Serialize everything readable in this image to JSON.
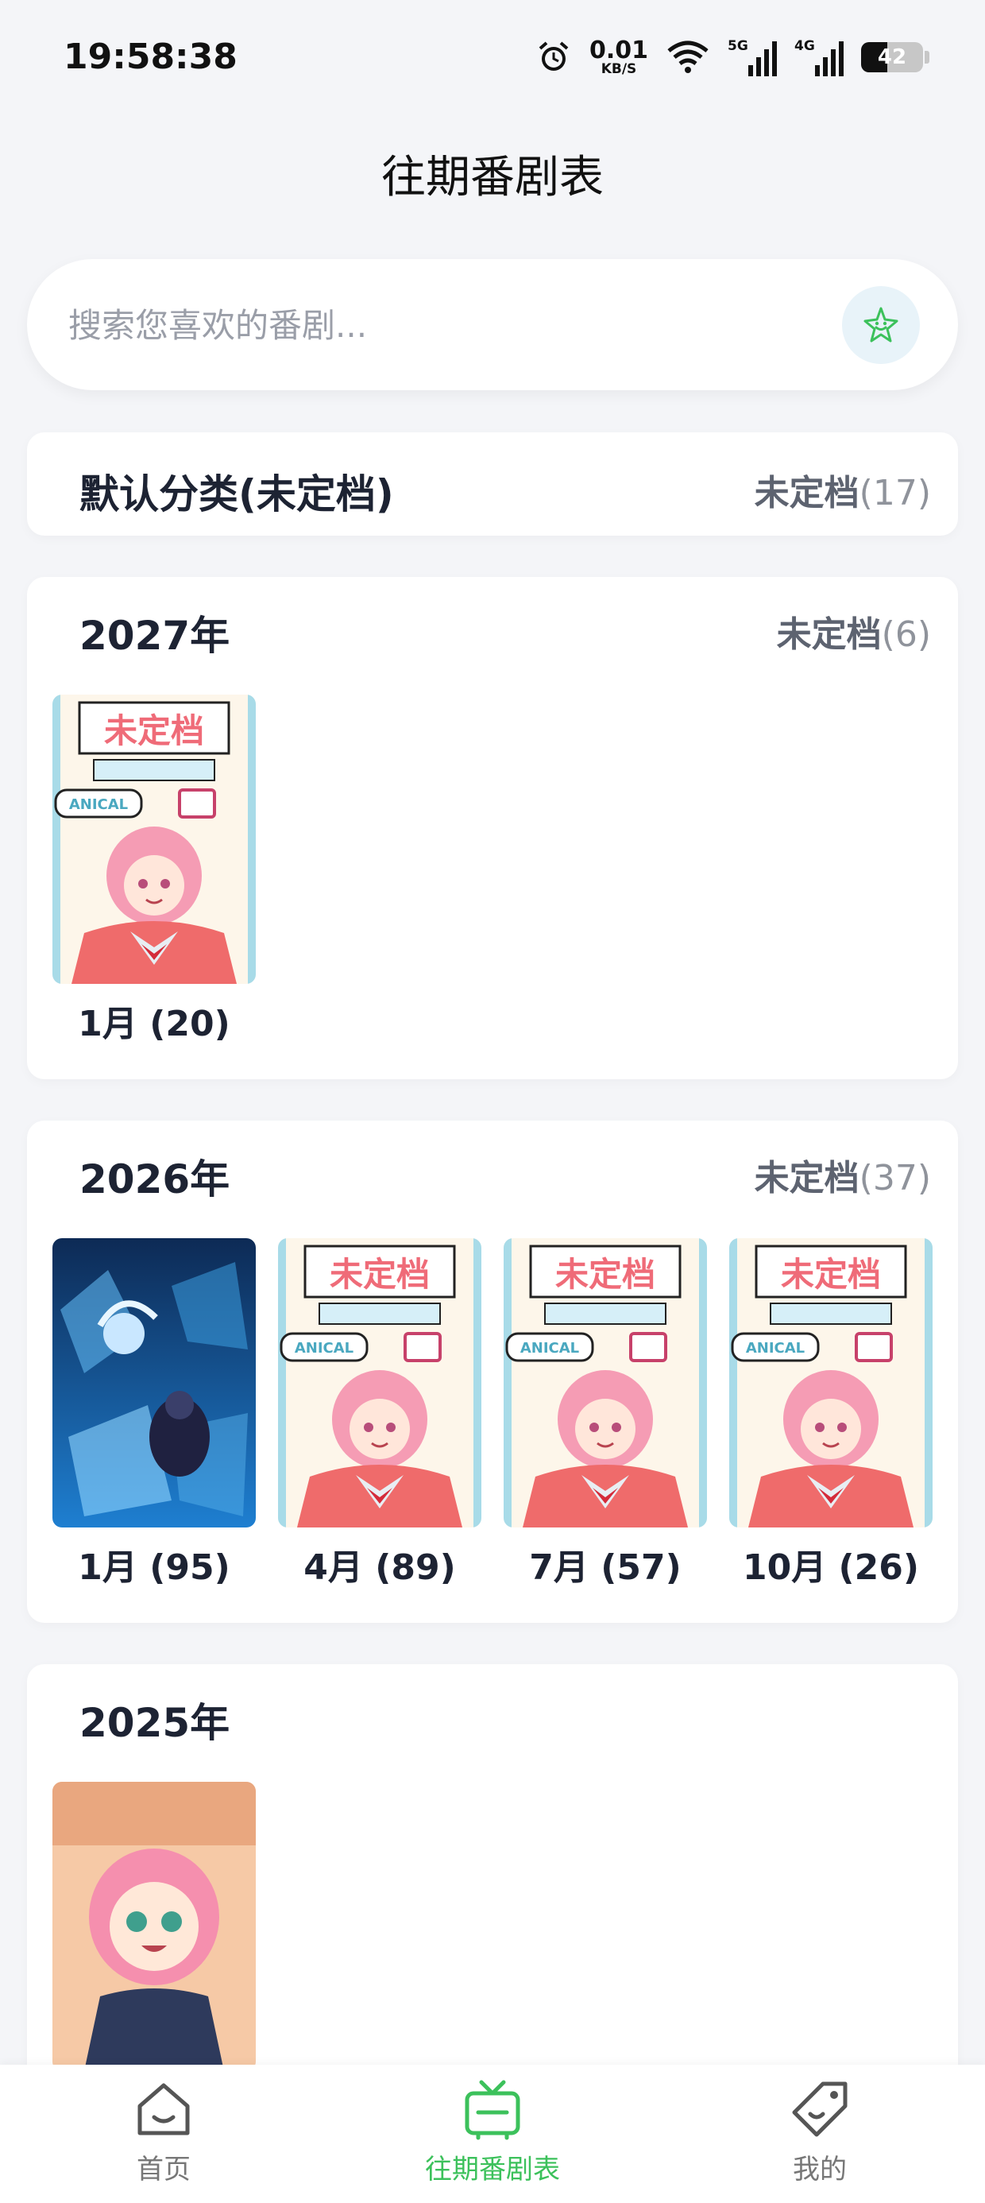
{
  "status_bar": {
    "time": "19:58:38",
    "net_speed_value": "0.01",
    "net_speed_unit": "KB/S",
    "sim1_tag": "5G",
    "sim2_tag": "4G",
    "battery": "42"
  },
  "header": {
    "title": "往期番剧表"
  },
  "search": {
    "placeholder": "搜索您喜欢的番剧..."
  },
  "default_category": {
    "title": "默认分类(未定档)",
    "meta_label": "未定档",
    "meta_count": "(17)"
  },
  "years": [
    {
      "title": "2027年",
      "meta_label": "未定档",
      "meta_count": "(6)",
      "seasons": [
        {
          "label": "1月 (20)",
          "poster": "anical-placeholder"
        }
      ]
    },
    {
      "title": "2026年",
      "meta_label": "未定档",
      "meta_count": "(37)",
      "seasons": [
        {
          "label": "1月 (95)",
          "poster": "crystal-blue-art"
        },
        {
          "label": "4月 (89)",
          "poster": "anical-placeholder"
        },
        {
          "label": "7月 (57)",
          "poster": "anical-placeholder"
        },
        {
          "label": "10月 (26)",
          "poster": "anical-placeholder"
        }
      ]
    },
    {
      "title": "2025年",
      "seasons": [
        {
          "label": "",
          "poster": "spy-family-art"
        }
      ]
    }
  ],
  "bottom_nav": {
    "items": [
      {
        "label": "首页",
        "icon": "home-icon",
        "active": false
      },
      {
        "label": "往期番剧表",
        "icon": "tv-icon",
        "active": true
      },
      {
        "label": "我的",
        "icon": "tag-icon",
        "active": false
      }
    ]
  },
  "colors": {
    "accent": "#3cc15b",
    "background": "#f4f5f8",
    "card": "#ffffff",
    "meta_label": "#5d6370"
  }
}
